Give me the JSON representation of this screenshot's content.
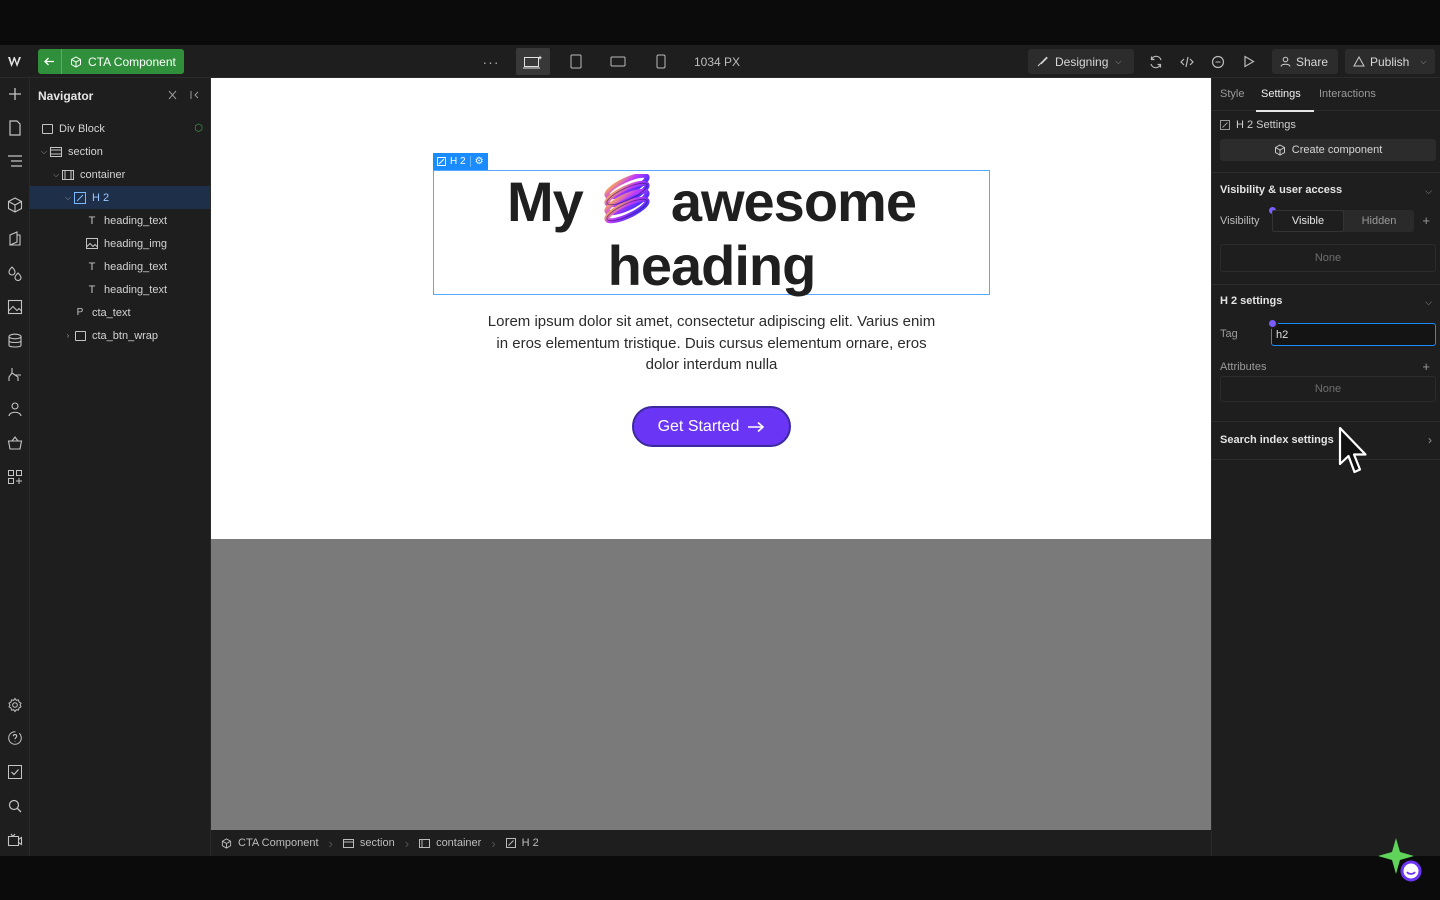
{
  "toolbar": {
    "component_label": "CTA Component",
    "more": "···",
    "viewport_readout": "1034 PX",
    "mode_label": "Designing",
    "share_label": "Share",
    "publish_label": "Publish"
  },
  "navigator": {
    "title": "Navigator",
    "items": [
      {
        "label": "Div Block"
      },
      {
        "label": "section"
      },
      {
        "label": "container"
      },
      {
        "label": "H 2"
      },
      {
        "label": "heading_text"
      },
      {
        "label": "heading_img"
      },
      {
        "label": "heading_text"
      },
      {
        "label": "heading_text"
      },
      {
        "label": "cta_text"
      },
      {
        "label": "cta_btn_wrap"
      }
    ]
  },
  "canvas": {
    "selection_tag": "H 2",
    "heading_line1_a": "My",
    "heading_line1_b": "awesome",
    "heading_line2": "heading",
    "paragraph": "Lorem ipsum dolor sit amet, consectetur adipiscing elit. Varius enim in eros elementum tristique. Duis cursus elementum ornare, eros dolor interdum nulla",
    "cta_label": "Get Started",
    "accent": "#6a35f5",
    "selection_color": "#1a8cff"
  },
  "breadcrumb": [
    "CTA Component",
    "section",
    "container",
    "H 2"
  ],
  "panel": {
    "tabs": [
      "Style",
      "Settings",
      "Interactions"
    ],
    "active_tab": "Settings",
    "element_settings_label": "H 2 Settings",
    "create_component": "Create component",
    "visibility_section": "Visibility & user access",
    "visibility_label": "Visibility",
    "visibility_options": [
      "Visible",
      "Hidden"
    ],
    "visibility_selected": "Visible",
    "conditions_none": "None",
    "h2_section": "H 2 settings",
    "tag_label": "Tag",
    "tag_value": "h2",
    "attributes_label": "Attributes",
    "attributes_none": "None",
    "search_index": "Search index settings"
  }
}
